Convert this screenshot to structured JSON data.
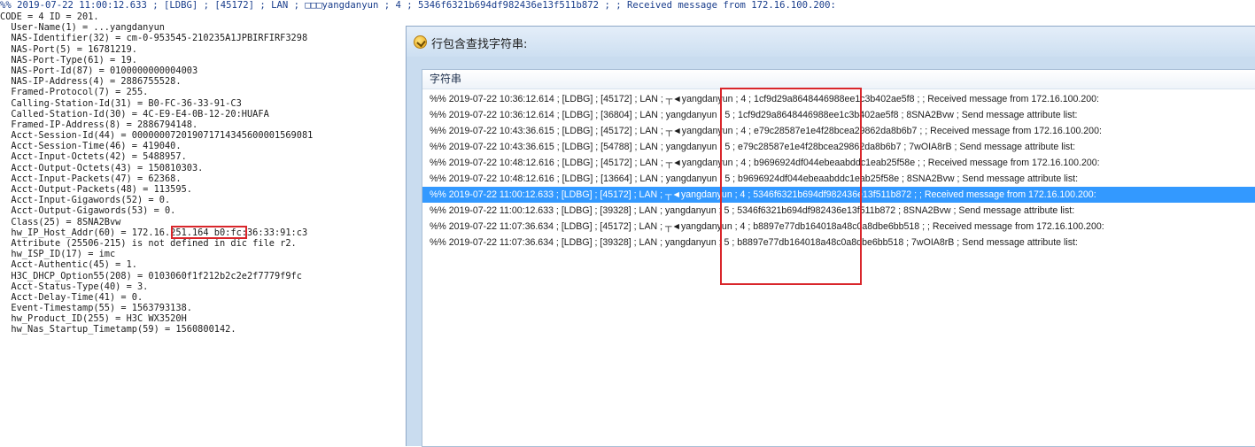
{
  "log_header": "%% 2019-07-22 11:00:12.633 ; [LDBG] ; [45172] ; LAN ; □□□yangdanyun ; 4 ; 5346f6321b694df982436e13f511b872 ;  ; Received message from 172.16.100.200:",
  "log_lines": [
    "CODE = 4 ID = 201.",
    "  User-Name(1) = ...yangdanyun",
    "  NAS-Identifier(32) = cm-0-953545-210235A1JPBIRFIRF3298",
    "  NAS-Port(5) = 16781219.",
    "  NAS-Port-Type(61) = 19.",
    "  NAS-Port-Id(87) = 0100000000004003",
    "  NAS-IP-Address(4) = 2886755528.",
    "  Framed-Protocol(7) = 255.",
    "  Calling-Station-Id(31) = B0-FC-36-33-91-C3",
    "  Called-Station-Id(30) = 4C-E9-E4-0B-12-20:HUAFA",
    "  Framed-IP-Address(8) = 2886794148.",
    "  Acct-Session-Id(44) = 000000072019071714345600001569081",
    "  Acct-Session-Time(46) = 419040.",
    "  Acct-Input-Octets(42) = 5488957.",
    "  Acct-Output-Octets(43) = 150810303.",
    "  Acct-Input-Packets(47) = 62368.",
    "  Acct-Output-Packets(48) = 113595.",
    "  Acct-Input-Gigawords(52) = 0.",
    "  Acct-Output-Gigawords(53) = 0.",
    "  Class(25) = 8SNA2Bvw",
    "  hw_IP_Host_Addr(60) = 172.16.251.164 b0:fc:36:33:91:c3",
    "  Attribute (25506-215) is not defined in dic file r2.",
    "  hw_ISP_ID(17) = imc",
    "  Acct-Authentic(45) = 1.",
    "  H3C_DHCP_Option55(208) = 0103060f1f212b2c2e2f7779f9fc",
    "  Acct-Status-Type(40) = 3.",
    "  Acct-Delay-Time(41) = 0.",
    "  Event-Timestamp(55) = 1563793138.",
    "  hw_Product_ID(255) = H3C WX3520H",
    "  hw_Nas_Startup_Timetamp(59) = 1560800142."
  ],
  "dialog": {
    "title": "行包含查找字符串:",
    "icon": "check-badge-icon",
    "column_header": "字符串",
    "selected_index": 6,
    "selected_color": "#3399ff",
    "rows": [
      "%% 2019-07-22 10:36:12.614 ; [LDBG] ; [45172] ; LAN ; ┬◄yangdanyun ; 4 ; 1cf9d29a8648446988ee1c3b402ae5f8 ;  ; Received message from 172.16.100.200:",
      "%% 2019-07-22 10:36:12.614 ; [LDBG] ; [36804] ; LAN ; yangdanyun ; 5 ; 1cf9d29a8648446988ee1c3b402ae5f8 ; 8SNA2Bvw ; Send message attribute list:",
      "%% 2019-07-22 10:43:36.615 ; [LDBG] ; [45172] ; LAN ; ┬◄yangdanyun ; 4 ; e79c28587e1e4f28bcea29862da8b6b7 ;  ; Received message from 172.16.100.200:",
      "%% 2019-07-22 10:43:36.615 ; [LDBG] ; [54788] ; LAN ; yangdanyun ; 5 ; e79c28587e1e4f28bcea29862da8b6b7 ; 7wOIA8rB ; Send message attribute list:",
      "%% 2019-07-22 10:48:12.616 ; [LDBG] ; [45172] ; LAN ; ┬◄yangdanyun ; 4 ; b9696924df044ebeaabddc1eab25f58e ;  ; Received message from 172.16.100.200:",
      "%% 2019-07-22 10:48:12.616 ; [LDBG] ; [13664] ; LAN ; yangdanyun ; 5 ; b9696924df044ebeaabddc1eab25f58e ; 8SNA2Bvw ; Send message attribute list:",
      "%% 2019-07-22 11:00:12.633 ; [LDBG] ; [45172] ; LAN ; ┬◄yangdanyun ; 4 ; 5346f6321b694df982436e13f511b872 ;  ; Received message from 172.16.100.200:",
      "%% 2019-07-22 11:00:12.633 ; [LDBG] ; [39328] ; LAN ; yangdanyun ; 5 ; 5346f6321b694df982436e13f511b872 ; 8SNA2Bvw ; Send message attribute list:",
      "%% 2019-07-22 11:07:36.634 ; [LDBG] ; [45172] ; LAN ; ┬◄yangdanyun ; 4 ; b8897e77db164018a48c0a8dbe6bb518 ;  ; Received message from 172.16.100.200:",
      "%% 2019-07-22 11:07:36.634 ; [LDBG] ; [39328] ; LAN ; yangdanyun ; 5 ; b8897e77db164018a48c0a8dbe6bb518 ; 7wOIA8rB ; Send message attribute list:"
    ]
  },
  "highlight_color": "#d9262b"
}
